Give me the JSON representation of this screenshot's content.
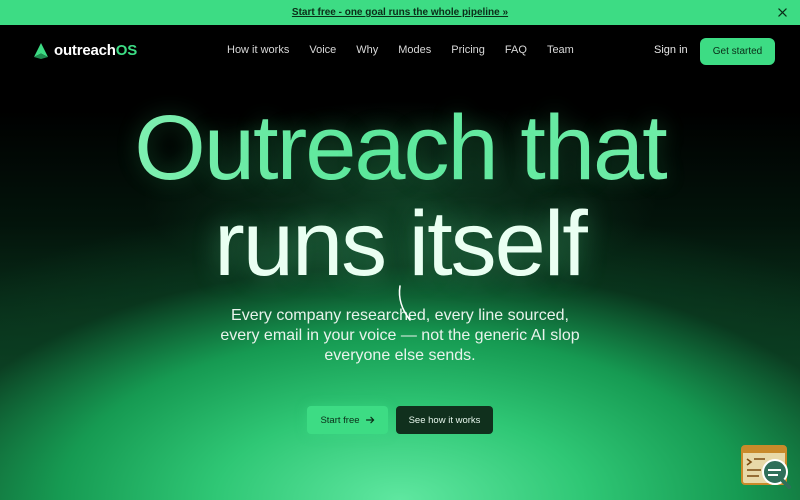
{
  "announcement": {
    "link_text": "Start free - one goal runs the whole pipeline »",
    "close_icon": "close-icon"
  },
  "brand": {
    "name_prefix": "outreach",
    "name_suffix": "OS",
    "accent_color": "#3ddc84"
  },
  "nav": {
    "links": [
      "How it works",
      "Voice",
      "Why",
      "Modes",
      "Pricing",
      "FAQ",
      "Team"
    ],
    "sign_in": "Sign in",
    "get_started": "Get started"
  },
  "hero": {
    "line1": "Outreach that",
    "line2": "runs itself",
    "subtitle_line1": "Every company researched, every line sourced,",
    "subtitle_line2": "every email in your voice — not the generic AI slop",
    "subtitle_line3": "everyone else sends.",
    "primary_cta": "Start free",
    "primary_cta_icon": "arrow-right-icon",
    "secondary_cta": "See how it works"
  },
  "widget": {
    "icon": "chat-support-icon"
  }
}
